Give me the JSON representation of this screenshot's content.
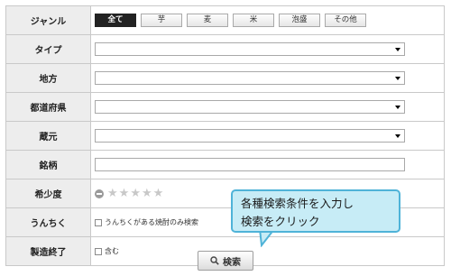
{
  "form": {
    "rows": [
      {
        "label": "ジャンル"
      },
      {
        "label": "タイプ"
      },
      {
        "label": "地方"
      },
      {
        "label": "都道府県"
      },
      {
        "label": "蔵元"
      },
      {
        "label": "銘柄"
      },
      {
        "label": "希少度"
      },
      {
        "label": "うんちく"
      },
      {
        "label": "製造終了"
      }
    ],
    "genre_options": [
      "全て",
      "芋",
      "麦",
      "米",
      "泡盛",
      "その他"
    ],
    "genre_selected": "全て",
    "rarity": {
      "value": 0,
      "max": 5
    },
    "unchiku_checkbox_label": "うんちくがある焼酎のみ検索",
    "discontinued_checkbox_label": "含む"
  },
  "search_button_label": "検索",
  "callout": {
    "line1": "各種検索条件を入力し",
    "line2": "検索をクリック"
  },
  "colors": {
    "label_bg": "#ededed",
    "border": "#c9c9c9",
    "active_segment": "#222222",
    "callout_bg": "#c7ecf6",
    "callout_border": "#4fb3d8"
  },
  "icons": [
    "magnifier-icon",
    "star-icon",
    "minus-circle-icon",
    "dropdown-arrow-icon"
  ]
}
